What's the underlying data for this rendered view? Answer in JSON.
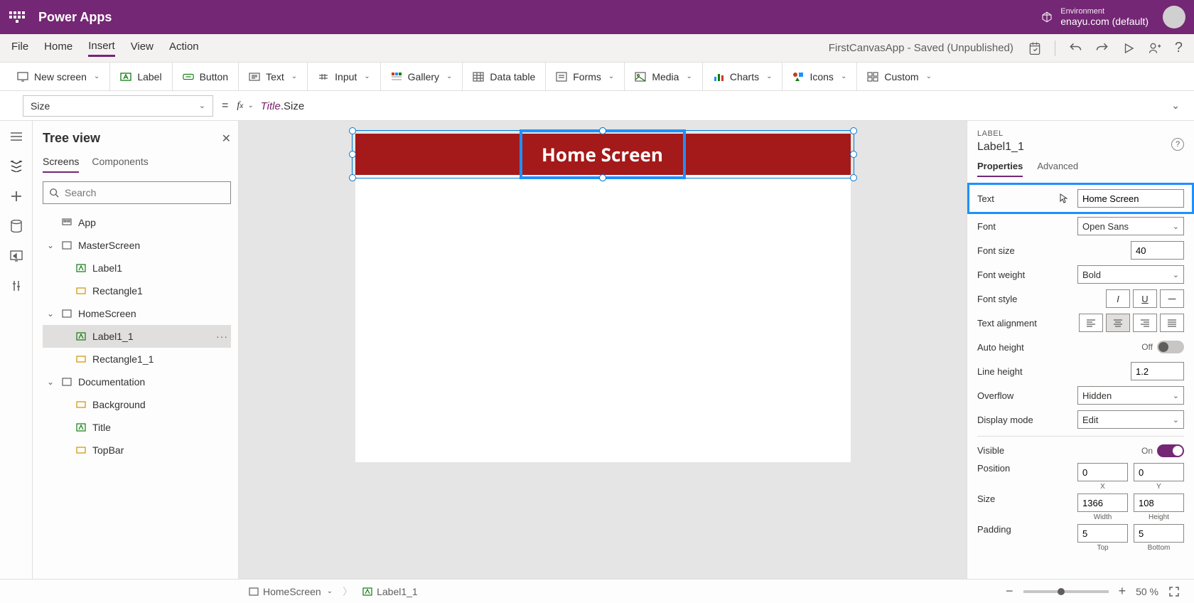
{
  "header": {
    "app_title": "Power Apps",
    "env_label": "Environment",
    "env_name": "enayu.com (default)"
  },
  "menu": {
    "items": [
      "File",
      "Home",
      "Insert",
      "View",
      "Action"
    ],
    "active": "Insert",
    "doc_title": "FirstCanvasApp - Saved (Unpublished)"
  },
  "ribbon": {
    "new_screen": "New screen",
    "label": "Label",
    "button": "Button",
    "text": "Text",
    "input": "Input",
    "gallery": "Gallery",
    "data_table": "Data table",
    "forms": "Forms",
    "media": "Media",
    "charts": "Charts",
    "icons": "Icons",
    "custom": "Custom"
  },
  "formula": {
    "property": "Size",
    "expr_obj": "Title",
    "expr_prop": ".Size"
  },
  "tree": {
    "title": "Tree view",
    "tabs": {
      "screens": "Screens",
      "components": "Components"
    },
    "search_placeholder": "Search",
    "app": "App",
    "master_screen": "MasterScreen",
    "label1": "Label1",
    "rectangle1": "Rectangle1",
    "home_screen": "HomeScreen",
    "label1_1": "Label1_1",
    "rectangle1_1": "Rectangle1_1",
    "documentation": "Documentation",
    "background": "Background",
    "title_node": "Title",
    "topbar": "TopBar"
  },
  "canvas": {
    "label_text": "Home Screen"
  },
  "props": {
    "category": "LABEL",
    "element_name": "Label1_1",
    "tabs": {
      "properties": "Properties",
      "advanced": "Advanced"
    },
    "text": {
      "label": "Text",
      "value": "Home Screen"
    },
    "font": {
      "label": "Font",
      "value": "Open Sans"
    },
    "font_size": {
      "label": "Font size",
      "value": "40"
    },
    "font_weight": {
      "label": "Font weight",
      "value": "Bold"
    },
    "font_style": {
      "label": "Font style"
    },
    "text_align": {
      "label": "Text alignment"
    },
    "auto_height": {
      "label": "Auto height",
      "state": "Off"
    },
    "line_height": {
      "label": "Line height",
      "value": "1.2"
    },
    "overflow": {
      "label": "Overflow",
      "value": "Hidden"
    },
    "display_mode": {
      "label": "Display mode",
      "value": "Edit"
    },
    "visible": {
      "label": "Visible",
      "state": "On"
    },
    "position": {
      "label": "Position",
      "x": "0",
      "y": "0",
      "xlabel": "X",
      "ylabel": "Y"
    },
    "size": {
      "label": "Size",
      "w": "1366",
      "h": "108",
      "wlabel": "Width",
      "hlabel": "Height"
    },
    "padding": {
      "label": "Padding",
      "top": "5",
      "bottom": "5",
      "toplabel": "Top",
      "bottomlabel": "Bottom"
    }
  },
  "bottom": {
    "screen": "HomeScreen",
    "element": "Label1_1",
    "zoom": "50",
    "zoom_pct": "%"
  }
}
